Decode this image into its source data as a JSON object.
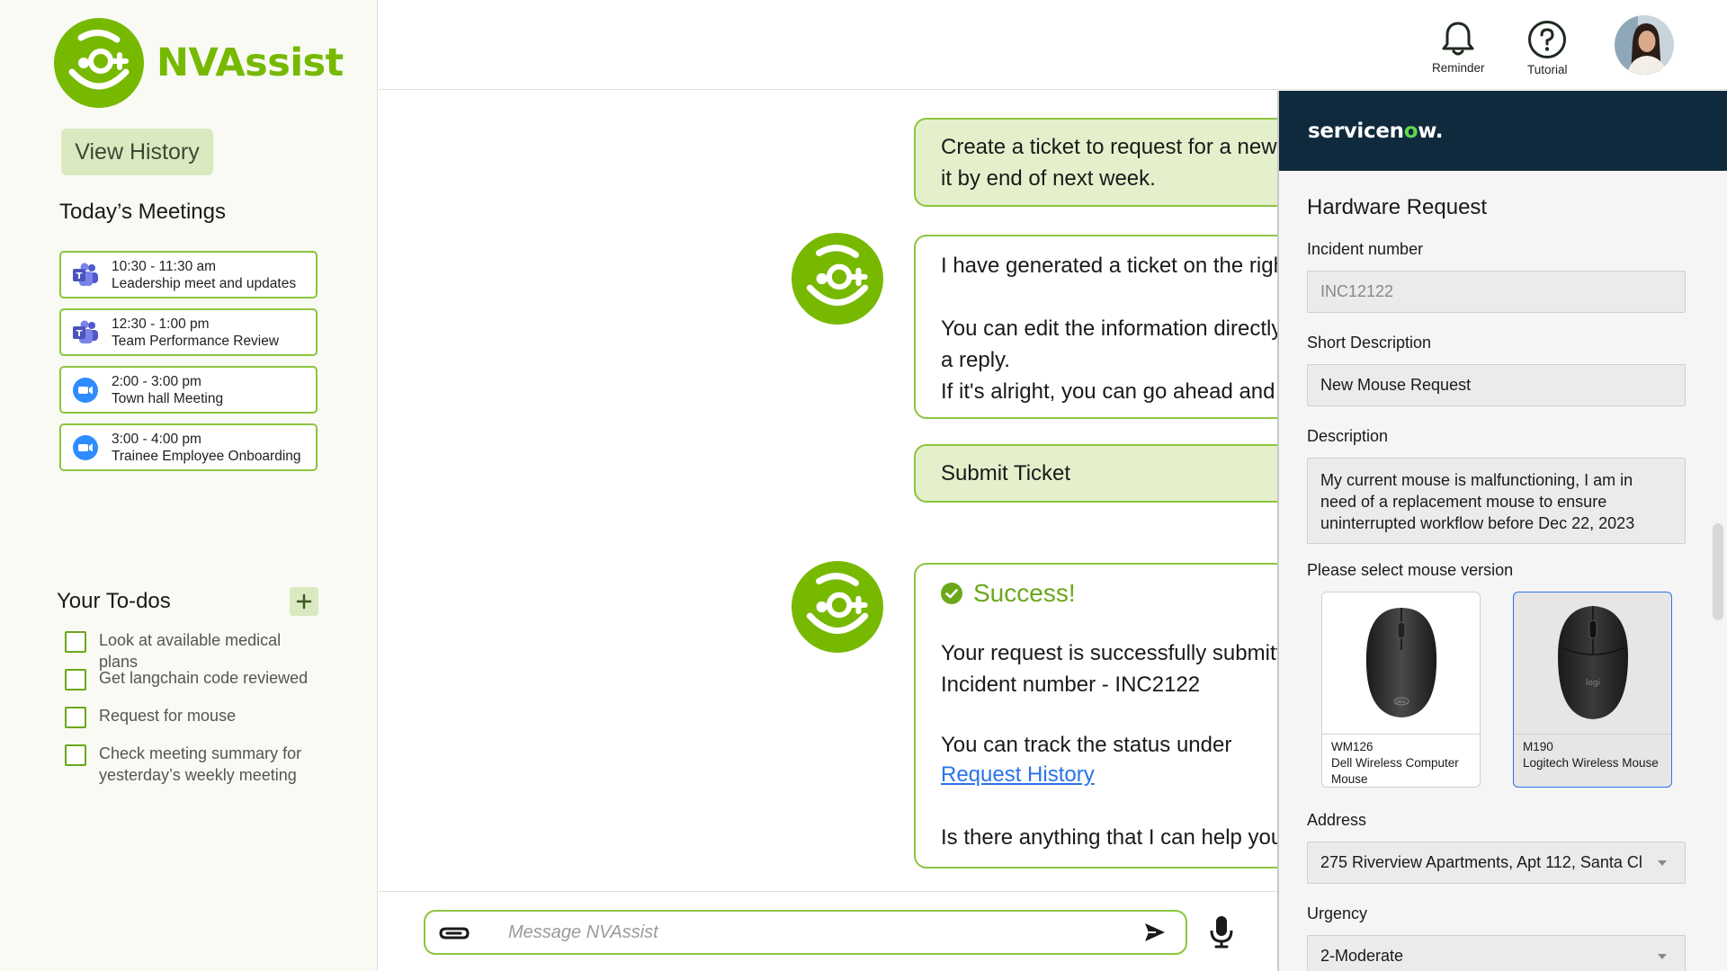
{
  "app": {
    "name": "NVAssist",
    "brand_color": "#76b900"
  },
  "sidebar": {
    "view_history_label": "View History",
    "meetings_title": "Today’s Meetings",
    "meetings": [
      {
        "time": "10:30 - 11:30 am",
        "title": "Leadership meet and updates",
        "icon": "teams-icon"
      },
      {
        "time": "12:30 - 1:00 pm",
        "title": "Team Performance Review",
        "icon": "teams-icon"
      },
      {
        "time": "2:00 - 3:00 pm",
        "title": "Town hall Meeting",
        "icon": "zoom-icon"
      },
      {
        "time": "3:00 - 4:00 pm",
        "title": "Trainee Employee Onboarding",
        "icon": "zoom-icon"
      }
    ],
    "todos_title": "Your To-dos",
    "todos": [
      "Look at available medical plans",
      "Get langchain code reviewed",
      "Request for mouse",
      "Check meeting summary for yesterday’s weekly meeting"
    ]
  },
  "header": {
    "reminder_label": "Reminder",
    "tutorial_label": "Tutorial"
  },
  "chat": {
    "messages": [
      {
        "role": "user",
        "text": "Create a ticket to request for a new mouse. I need it by end of next week."
      },
      {
        "role": "bot",
        "lines": [
          "I have generated a ticket on the right.",
          "You can edit the information directly or just send me a reply.",
          "If it's alright, you can go ahead and submit the request!"
        ]
      },
      {
        "role": "user",
        "text": "Submit Ticket"
      },
      {
        "role": "bot",
        "success_title": "Success!",
        "lines": [
          "Your request is successfully submitted!",
          "Incident number - INC2122",
          "You can track the status under",
          "Request History",
          "Is there anything that I can help you with?"
        ]
      }
    ],
    "composer_placeholder": "Message NVAssist"
  },
  "servicenow": {
    "logo_pre": "servicen",
    "logo_o": "o",
    "logo_post": "w.",
    "form_title": "Hardware Request",
    "incident_label": "Incident number",
    "incident_value": "INC12122",
    "short_desc_label": "Short Description",
    "short_desc_value": "New Mouse Request",
    "desc_label": "Description",
    "desc_value": "My current mouse is malfunctioning, I am in need of a replacement mouse to ensure uninterrupted workflow before Dec 22, 2023",
    "mouse_label": "Please select mouse version",
    "mouse_options": [
      {
        "model": "WM126",
        "name": "Dell Wireless Computer Mouse",
        "brand_mark": "DELL",
        "selected": false
      },
      {
        "model": "M190",
        "name": "Logitech Wireless Mouse",
        "brand_mark": "logi",
        "selected": true
      }
    ],
    "address_label": "Address",
    "address_value": "275 Riverview Apartments, Apt 112, Santa Cl",
    "urgency_label": "Urgency",
    "urgency_value": "2-Moderate"
  }
}
